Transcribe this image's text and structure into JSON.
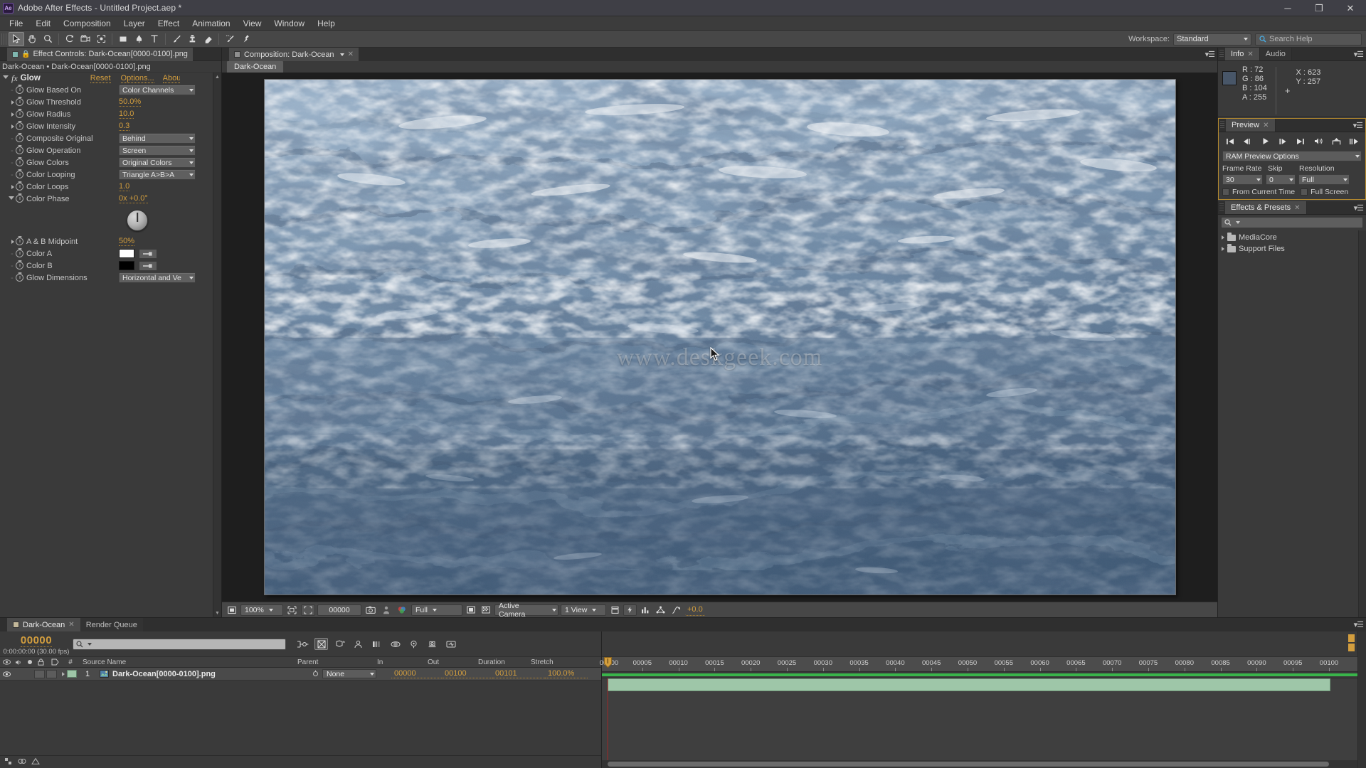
{
  "window": {
    "title": "Adobe After Effects - Untitled Project.aep *",
    "logo": "Ae",
    "minimize": "─",
    "maximize": "❐",
    "close": "✕"
  },
  "menubar": {
    "items": [
      "File",
      "Edit",
      "Composition",
      "Layer",
      "Effect",
      "Animation",
      "View",
      "Window",
      "Help"
    ]
  },
  "toolbar": {
    "workspace_label": "Workspace:",
    "workspace_value": "Standard",
    "search_help_placeholder": "Search Help",
    "tools": [
      "selection-tool",
      "hand-tool",
      "zoom-tool",
      "rotation-tool",
      "camera-tool",
      "pan-behind-tool",
      "shape-tool",
      "pen-tool",
      "type-tool",
      "brush-tool",
      "clone-stamp-tool",
      "eraser-tool",
      "roto-brush-tool",
      "puppet-pin-tool"
    ]
  },
  "effect_controls": {
    "tab_title": "Effect Controls: Dark-Ocean[0000-0100].png",
    "breadcrumb": "Dark-Ocean • Dark-Ocean[0000-0100].png",
    "effect_name": "Glow",
    "fx_label": "fx",
    "reset_label": "Reset",
    "options_label": "Options...",
    "about_label": "About...",
    "properties": [
      {
        "name": "Glow Based On",
        "type": "dropdown",
        "value": "Color Channels",
        "expand": false
      },
      {
        "name": "Glow Threshold",
        "type": "value",
        "value": "50.0%",
        "expand": true
      },
      {
        "name": "Glow Radius",
        "type": "value",
        "value": "10.0",
        "expand": true
      },
      {
        "name": "Glow Intensity",
        "type": "value",
        "value": "0.3",
        "expand": true
      },
      {
        "name": "Composite Original",
        "type": "dropdown",
        "value": "Behind",
        "expand": false
      },
      {
        "name": "Glow Operation",
        "type": "dropdown",
        "value": "Screen",
        "expand": false
      },
      {
        "name": "Glow Colors",
        "type": "dropdown",
        "value": "Original Colors",
        "expand": false
      },
      {
        "name": "Color Looping",
        "type": "dropdown",
        "value": "Triangle A>B>A",
        "expand": false
      },
      {
        "name": "Color Loops",
        "type": "value",
        "value": "1.0",
        "expand": true
      },
      {
        "name": "Color Phase",
        "type": "dial",
        "value": "0x +0.0°",
        "expand": true
      },
      {
        "name": "A & B Midpoint",
        "type": "value",
        "value": "50%",
        "expand": true
      },
      {
        "name": "Color A",
        "type": "color",
        "value": "#ffffff",
        "expand": false
      },
      {
        "name": "Color B",
        "type": "color",
        "value": "#000000",
        "expand": false
      },
      {
        "name": "Glow Dimensions",
        "type": "dropdown",
        "value": "Horizontal and Ve",
        "expand": false
      }
    ]
  },
  "composition": {
    "tab_title": "Composition: Dark-Ocean",
    "sub_tab": "Dark-Ocean",
    "watermark": "www.deskgeek.com",
    "viewer_toolbar": {
      "zoom": "100%",
      "time": "00000",
      "resolution": "Full",
      "camera": "Active Camera",
      "views": "1 View",
      "exposure": "+0.0"
    }
  },
  "info": {
    "tabs": [
      "Info",
      "Audio"
    ],
    "active_tab": "Info",
    "r_label": "R :",
    "r_value": "72",
    "g_label": "G :",
    "g_value": "86",
    "b_label": "B :",
    "b_value": "104",
    "a_label": "A :",
    "a_value": "255",
    "x_label": "X :",
    "x_value": "623",
    "y_label": "Y :",
    "y_value": "257",
    "sample_color": "#485668"
  },
  "preview": {
    "tab": "Preview",
    "ram_preview_options": "RAM Preview Options",
    "frame_rate_label": "Frame Rate",
    "frame_rate_value": "30",
    "skip_label": "Skip",
    "skip_value": "0",
    "resolution_label": "Resolution",
    "resolution_value": "Full",
    "from_current_time": "From Current Time",
    "full_screen": "Full Screen",
    "transport": [
      "first-frame-icon",
      "previous-frame-icon",
      "play-icon",
      "next-frame-icon",
      "last-frame-icon",
      "audio-icon",
      "ram-preview-icon",
      "loop-icon"
    ]
  },
  "effects_presets": {
    "tab": "Effects & Presets",
    "search_placeholder": "",
    "items": [
      "MediaCore",
      "Support Files"
    ]
  },
  "timeline": {
    "tabs": [
      {
        "label": "Dark-Ocean",
        "active": true,
        "closable": true
      },
      {
        "label": "Render Queue",
        "active": false,
        "closable": false
      }
    ],
    "timecode": "00000",
    "timecode_sub": "0:00:00:00 (30.00 fps)",
    "search_placeholder": "",
    "columns": [
      "#",
      "Source Name",
      "Parent",
      "In",
      "Out",
      "Duration",
      "Stretch"
    ],
    "layers": [
      {
        "index": "1",
        "source_name": "Dark-Ocean[0000-0100].png",
        "parent": "None",
        "in": "00000",
        "out": "00100",
        "duration": "00101",
        "stretch": "100.0%"
      }
    ],
    "ruler_ticks": [
      "00005",
      "00010",
      "00015",
      "00020",
      "00025",
      "00030",
      "00035",
      "00040",
      "00045",
      "00050",
      "00055",
      "00060",
      "00065",
      "00070",
      "00075",
      "00080",
      "00085",
      "00090",
      "00095",
      "00100"
    ],
    "ruler_start": "00000"
  },
  "colors": {
    "accent_orange": "#d39e3e",
    "panel_bg": "#3a3a3a",
    "panel_dark": "#2f2f2f",
    "stage_bg": "#1e1e1e",
    "timeline_green": "#39b54a",
    "layerbar_green": "#9ec6a8",
    "playhead_red": "#9b2a2a",
    "preview_border": "#b58a2e"
  }
}
